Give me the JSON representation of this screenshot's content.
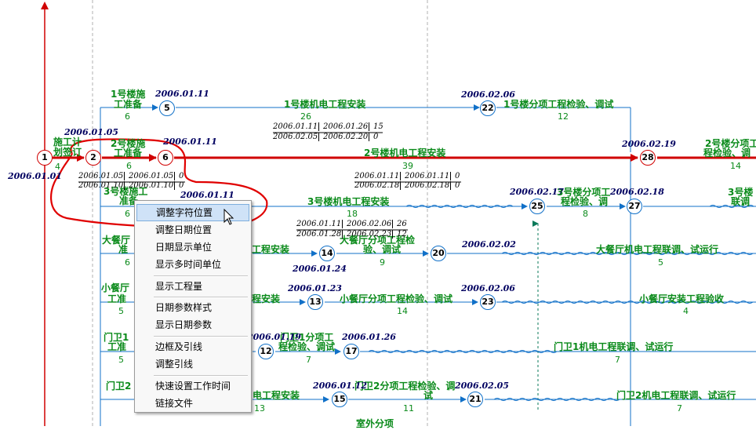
{
  "colors": {
    "network_line": "#1070c8",
    "critical_path": "#d00000",
    "task_label": "#0a8a1a",
    "date_label": "#000060",
    "annotation": "#e00000"
  },
  "nodes": [
    {
      "id": "1",
      "critical": true
    },
    {
      "id": "2",
      "critical": true
    },
    {
      "id": "5",
      "critical": false
    },
    {
      "id": "6",
      "critical": true
    },
    {
      "id": "22",
      "critical": false
    },
    {
      "id": "28",
      "critical": true
    },
    {
      "id": "25",
      "critical": false
    },
    {
      "id": "27",
      "critical": false
    },
    {
      "id": "14",
      "critical": false
    },
    {
      "id": "20",
      "critical": false
    },
    {
      "id": "13",
      "critical": false
    },
    {
      "id": "23",
      "critical": false
    },
    {
      "id": "12",
      "critical": false
    },
    {
      "id": "17",
      "critical": false
    },
    {
      "id": "15",
      "critical": false
    },
    {
      "id": "21",
      "critical": false
    }
  ],
  "task_labels": [
    {
      "text": "施工计"
    },
    {
      "text": "划签订"
    },
    {
      "text": "1号楼施"
    },
    {
      "text": "工准备"
    },
    {
      "text": "1号楼机电工程安装"
    },
    {
      "text": "1号楼分项工程检验、调试"
    },
    {
      "text": "2号楼施"
    },
    {
      "text": "工准备"
    },
    {
      "text": "2号楼机电工程安装"
    },
    {
      "text": "2号楼分项工"
    },
    {
      "text": "程检验、调"
    },
    {
      "text": "3号楼施工"
    },
    {
      "text": "准备"
    },
    {
      "text": "3号楼机电工程安装"
    },
    {
      "text": "3号楼分项工"
    },
    {
      "text": "程检验、调"
    },
    {
      "text": "3号楼"
    },
    {
      "text": "联调"
    },
    {
      "text": "大餐厅"
    },
    {
      "text": "准"
    },
    {
      "text": "工程安装"
    },
    {
      "text": "大餐厅分项工程检"
    },
    {
      "text": "验、调试"
    },
    {
      "text": "大餐厅机电工程联调、试运行"
    },
    {
      "text": "小餐厅"
    },
    {
      "text": "工准"
    },
    {
      "text": "程安装"
    },
    {
      "text": "小餐厅分项工程检验、调试"
    },
    {
      "text": "小餐厅安装工程验收"
    },
    {
      "text": "门卫1"
    },
    {
      "text": "工准"
    },
    {
      "text": "门卫1分项工"
    },
    {
      "text": "程检验、调试"
    },
    {
      "text": "门卫1机电工程联调、试运行"
    },
    {
      "text": "门卫2"
    },
    {
      "text": "电工程安装"
    },
    {
      "text": "门卫2分项工程检验、调"
    },
    {
      "text": "试"
    },
    {
      "text": "门卫2机电工程联调、试运行"
    },
    {
      "text": "室外分项"
    }
  ],
  "durations": [
    {
      "text": "4"
    },
    {
      "text": "6"
    },
    {
      "text": "26"
    },
    {
      "text": "12"
    },
    {
      "text": "6"
    },
    {
      "text": "39"
    },
    {
      "text": "14"
    },
    {
      "text": "6"
    },
    {
      "text": "18"
    },
    {
      "text": "8"
    },
    {
      "text": "6"
    },
    {
      "text": "9"
    },
    {
      "text": "5"
    },
    {
      "text": "5"
    },
    {
      "text": "14"
    },
    {
      "text": "4"
    },
    {
      "text": "5"
    },
    {
      "text": "7"
    },
    {
      "text": "7"
    },
    {
      "text": "13"
    },
    {
      "text": "11"
    },
    {
      "text": "7"
    }
  ],
  "dates": [
    {
      "text": "2006.01.01"
    },
    {
      "text": "2006.01.05"
    },
    {
      "text": "2006.01.11"
    },
    {
      "text": "2006.01.11"
    },
    {
      "text": "2006.02.06"
    },
    {
      "text": "2006.02.19"
    },
    {
      "text": "2006.01.11"
    },
    {
      "text": "2006.02.17"
    },
    {
      "text": "2006.02.18"
    },
    {
      "text": "2006.01.24"
    },
    {
      "text": "2006.02.02"
    },
    {
      "text": "2006.01.23"
    },
    {
      "text": "2006.02.06"
    },
    {
      "text": "2006.01.19"
    },
    {
      "text": "2006.01.26"
    },
    {
      "text": "2006.01.12"
    },
    {
      "text": "2006.02.05"
    }
  ],
  "date_params": [
    {
      "text": "2006.01.11",
      "sep": true
    },
    {
      "text": "2006.01.26",
      "sep": true
    },
    {
      "text": "15",
      "sep": false
    },
    {
      "text": "2006.02.05",
      "sep": true
    },
    {
      "text": "2006.02.20",
      "sep": true
    },
    {
      "text": "0",
      "sep": false
    },
    {
      "text": "2006.01.05",
      "sep": true
    },
    {
      "text": "2006.01.05",
      "sep": true
    },
    {
      "text": "0",
      "sep": false
    },
    {
      "text": "2006.01.10",
      "sep": true
    },
    {
      "text": "2006.01.10",
      "sep": true
    },
    {
      "text": "0",
      "sep": false
    },
    {
      "text": "2006.01.11",
      "sep": true
    },
    {
      "text": "2006.01.11",
      "sep": true
    },
    {
      "text": "0",
      "sep": false
    },
    {
      "text": "2006.02.18",
      "sep": true
    },
    {
      "text": "2006.02.18",
      "sep": true
    },
    {
      "text": "0",
      "sep": false
    },
    {
      "text": "2006.01.11",
      "sep": true
    },
    {
      "text": "2006.02.06",
      "sep": true
    },
    {
      "text": "26",
      "sep": false
    },
    {
      "text": "2006.01.28",
      "sep": true
    },
    {
      "text": "2006.02.23",
      "sep": true
    },
    {
      "text": "12",
      "sep": false
    }
  ],
  "context_menu": {
    "items": [
      {
        "label": "调整字符位置",
        "highlighted": true
      },
      {
        "label": "调整日期位置"
      },
      {
        "label": "日期显示单位"
      },
      {
        "label": "显示多时间单位"
      },
      {
        "label": "显示工程量"
      },
      {
        "label": "日期参数样式"
      },
      {
        "label": "显示日期参数"
      },
      {
        "label": "边框及引线"
      },
      {
        "label": "调整引线"
      },
      {
        "label": "快速设置工作时间"
      },
      {
        "label": "链接文件"
      }
    ]
  }
}
